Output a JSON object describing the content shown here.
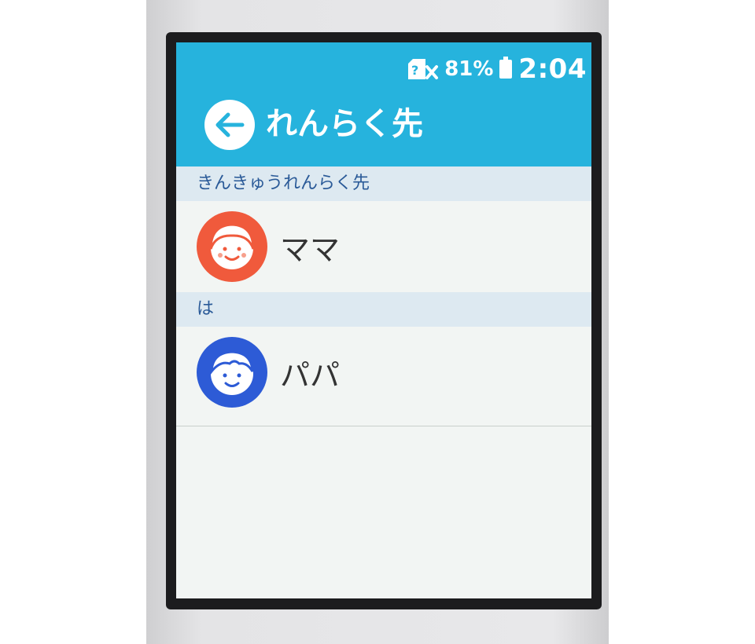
{
  "status_bar": {
    "signal_icon": "no-sim-icon",
    "battery_percent": "81%",
    "battery_icon": "battery-icon",
    "time": "2:04"
  },
  "header": {
    "back_icon": "arrow-left-icon",
    "title": "れんらく先"
  },
  "sections": [
    {
      "header": "きんきゅうれんらく先",
      "contacts": [
        {
          "name": "ママ",
          "avatar": "mama-avatar-icon",
          "avatar_color": "#f05a3c"
        }
      ]
    },
    {
      "header": "は",
      "contacts": [
        {
          "name": "パパ",
          "avatar": "papa-avatar-icon",
          "avatar_color": "#2d5bd6"
        }
      ]
    }
  ],
  "colors": {
    "header_bg": "#26b3dd",
    "section_bg": "#dde9f1",
    "section_text": "#2a5a98",
    "screen_bg": "#f2f5f3"
  }
}
